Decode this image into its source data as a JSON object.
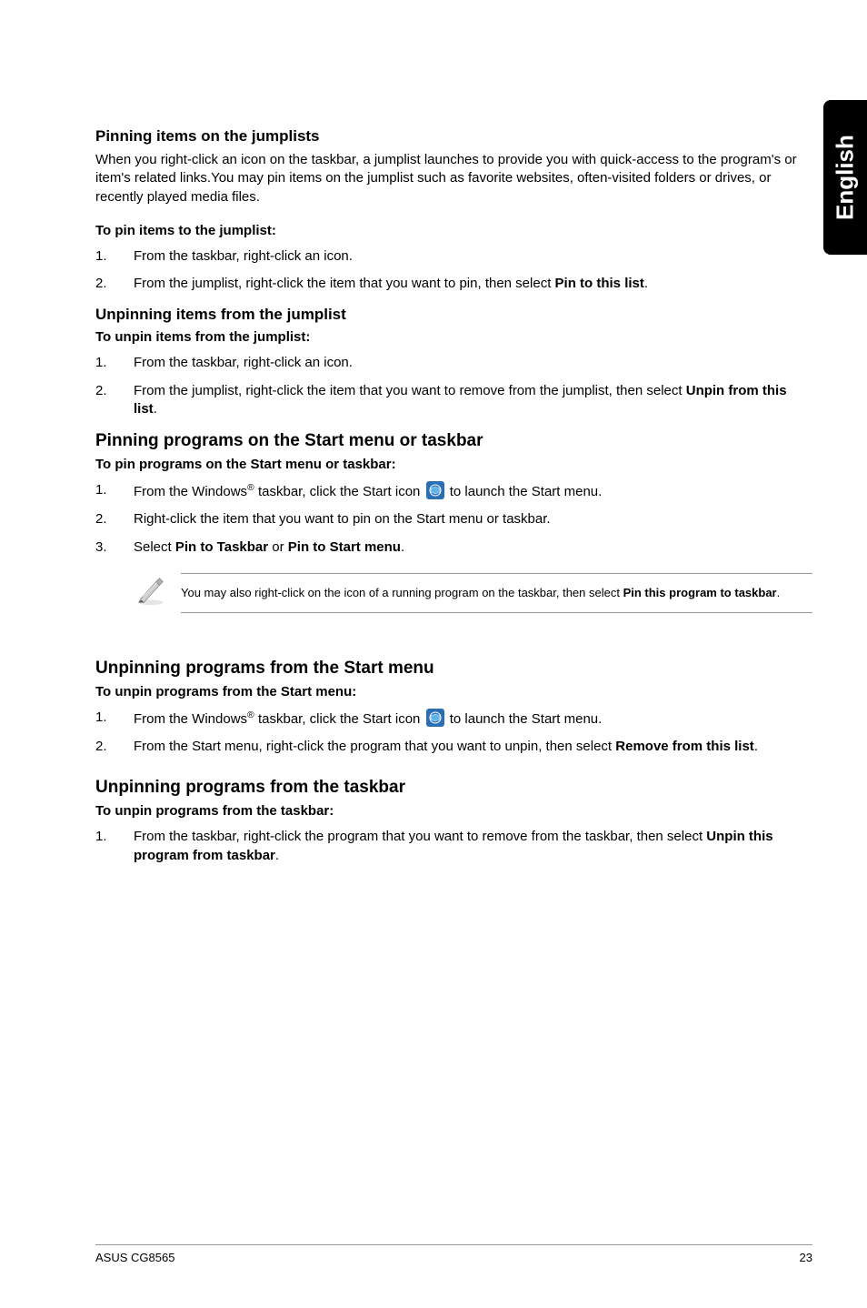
{
  "sideTab": "English",
  "s1": {
    "title": "Pinning items on the jumplists",
    "intro": "When you right-click an icon on the taskbar, a jumplist launches to provide you with quick-access to the program's or item's related links.You may pin items on the jumplist such as favorite websites, often-visited folders or drives, or recently played media files.",
    "sub": "To pin items to the jumplist:",
    "i1n": "1.",
    "i1": "From the taskbar, right-click an icon.",
    "i2n": "2.",
    "i2a": "From the jumplist, right-click the item that you want to pin, then select ",
    "i2b": "Pin to this list",
    "i2c": "."
  },
  "s2": {
    "title": "Unpinning items from the jumplist",
    "sub": "To unpin items from the jumplist:",
    "i1n": "1.",
    "i1": "From the taskbar, right-click an icon.",
    "i2n": "2.",
    "i2a": "From the jumplist, right-click the item that you want to remove from the jumplist, then select ",
    "i2b": "Unpin from this list",
    "i2c": "."
  },
  "s3": {
    "title": "Pinning programs on the Start menu or taskbar",
    "sub": "To pin programs on the Start menu or taskbar:",
    "i1n": "1.",
    "i1a": "From the Windows",
    "i1b": " taskbar, click the Start icon ",
    "i1c": " to launch the Start menu.",
    "i2n": "2.",
    "i2": "Right-click the item that you want to pin on the Start menu or taskbar.",
    "i3n": "3.",
    "i3a": "Select ",
    "i3b": "Pin to Taskbar",
    "i3c": " or ",
    "i3d": "Pin to Start menu",
    "i3e": "."
  },
  "note": {
    "a": "You may also right-click on the icon of a running program on the taskbar, then select ",
    "b": "Pin this program to taskbar",
    "c": "."
  },
  "s4": {
    "title": "Unpinning programs from the Start menu",
    "sub": "To unpin programs from the Start menu:",
    "i1n": "1.",
    "i1a": "From the Windows",
    "i1b": " taskbar, click the Start icon ",
    "i1c": " to launch the Start menu.",
    "i2n": "2.",
    "i2a": "From the Start menu, right-click the program that you want to unpin, then select ",
    "i2b": "Remove from this list",
    "i2c": "."
  },
  "s5": {
    "title": "Unpinning programs from the taskbar",
    "sub": "To unpin programs from the taskbar:",
    "i1n": "1.",
    "i1a": "From the taskbar, right-click the program that you want to remove from the taskbar, then select ",
    "i1b": "Unpin this program from taskbar",
    "i1c": "."
  },
  "footer": {
    "left": "ASUS CG8565",
    "right": "23"
  },
  "reg": "®"
}
